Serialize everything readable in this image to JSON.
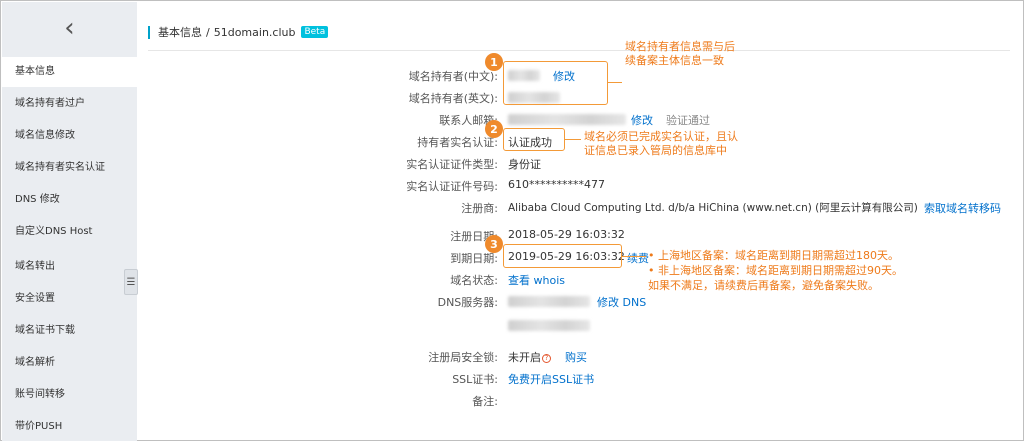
{
  "sidebar": {
    "back_icon": "chevron-left-icon",
    "items": [
      {
        "label": "基本信息",
        "active": true
      },
      {
        "label": "域名持有者过户"
      },
      {
        "label": "域名信息修改"
      },
      {
        "label": "域名持有者实名认证"
      },
      {
        "label": "DNS 修改"
      },
      {
        "label": "自定义DNS Host"
      },
      {
        "label": "域名转出"
      },
      {
        "label": "安全设置"
      },
      {
        "label": "域名证书下载"
      },
      {
        "label": "域名解析"
      },
      {
        "label": "账号间转移"
      },
      {
        "label": "带价PUSH"
      }
    ],
    "collapse_icon": "collapse-menu-icon"
  },
  "breadcrumb": {
    "section": "基本信息",
    "separator": "/",
    "domain": "51domain.club",
    "badge": "Beta"
  },
  "fields": {
    "owner_cn_label": "域名持有者(中文):",
    "owner_en_label": "域名持有者(英文):",
    "owner_edit": "修改",
    "email_label": "联系人邮箱:",
    "email_edit": "修改",
    "email_status": "验证通过",
    "verify_label": "持有者实名认证:",
    "verify_value": "认证成功",
    "idtype_label": "实名认证证件类型:",
    "idtype_value": "身份证",
    "idnum_label": "实名认证证件号码:",
    "idnum_value": "610**********477",
    "registrar_label": "注册商:",
    "registrar_value": "Alibaba Cloud Computing Ltd. d/b/a HiChina (www.net.cn) (阿里云计算有限公司)",
    "registrar_link": "索取域名转移码",
    "regdate_label": "注册日期:",
    "regdate_value": "2018-05-29 16:03:32",
    "expdate_label": "到期日期:",
    "expdate_value": "2019-05-29 16:03:32",
    "renew_link": "续费",
    "status_label": "域名状态:",
    "status_link": "查看 whois",
    "dns_label": "DNS服务器:",
    "dns_edit": "修改 DNS",
    "lock_label": "注册局安全锁:",
    "lock_value": "未开启",
    "lock_help": "?",
    "lock_buy": "购买",
    "ssl_label": "SSL证书:",
    "ssl_link": "免费开启SSL证书",
    "remark_label": "备注:"
  },
  "annotations": [
    {
      "number": "1",
      "lines": [
        "域名持有者信息需与后",
        "续备案主体信息一致"
      ]
    },
    {
      "number": "2",
      "lines": [
        "域名必须已完成实名认证，且认",
        "证信息已录入管局的信息库中"
      ]
    },
    {
      "number": "3",
      "lines": [
        "•   上海地区备案：域名距离到期日期需超过180天。",
        "•   非上海地区备案：域名距离到期日期需超过90天。",
        "如果不满足，请续费后再备案，避免备案失败。"
      ]
    }
  ],
  "colors": {
    "accent": "#00a2ca",
    "link": "#0070cc",
    "annotation": "#f39a38",
    "sidebar_bg": "#eaedf1"
  }
}
